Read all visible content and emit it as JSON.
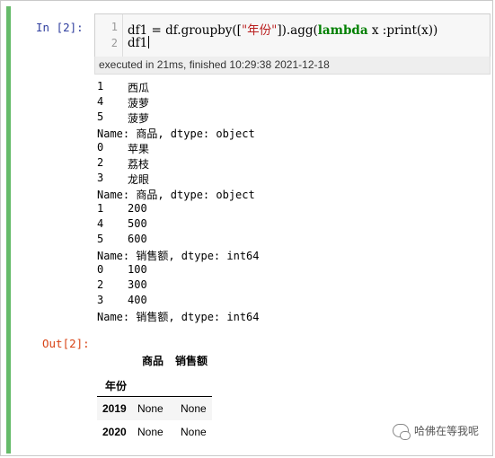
{
  "cell": {
    "in_prompt": "In  [2]:",
    "out_prompt": "Out[2]:",
    "line_numbers": [
      "1",
      "2"
    ],
    "code": {
      "line1_a": "df1 = df.groupby([",
      "line1_str": "\"年份\"",
      "line1_b": "]).agg(",
      "line1_kw": "lambda",
      "line1_c": " x :print(x))",
      "line2": "df1"
    },
    "exec_info": "executed in 21ms, finished 10:29:38 2021-12-18"
  },
  "stdout": [
    {
      "idx": "1",
      "val": "西瓜"
    },
    {
      "idx": "4",
      "val": "菠萝"
    },
    {
      "idx": "5",
      "val": "菠萝"
    },
    {
      "line": "Name: 商品, dtype: object"
    },
    {
      "idx": "0",
      "val": "苹果"
    },
    {
      "idx": "2",
      "val": "荔枝"
    },
    {
      "idx": "3",
      "val": "龙眼"
    },
    {
      "line": "Name: 商品, dtype: object"
    },
    {
      "idx": "1",
      "val": "200"
    },
    {
      "idx": "4",
      "val": "500"
    },
    {
      "idx": "5",
      "val": "600"
    },
    {
      "line": "Name: 销售额, dtype: int64"
    },
    {
      "idx": "0",
      "val": "100"
    },
    {
      "idx": "2",
      "val": "300"
    },
    {
      "idx": "3",
      "val": "400"
    },
    {
      "line": "Name: 销售额, dtype: int64"
    }
  ],
  "dataframe": {
    "columns": [
      "商品",
      "销售额"
    ],
    "index_name": "年份",
    "rows": [
      {
        "index": "2019",
        "values": [
          "None",
          "None"
        ]
      },
      {
        "index": "2020",
        "values": [
          "None",
          "None"
        ]
      }
    ]
  },
  "watermark": {
    "text": "哈佛在等我呢",
    "icon": "wechat-icon"
  }
}
